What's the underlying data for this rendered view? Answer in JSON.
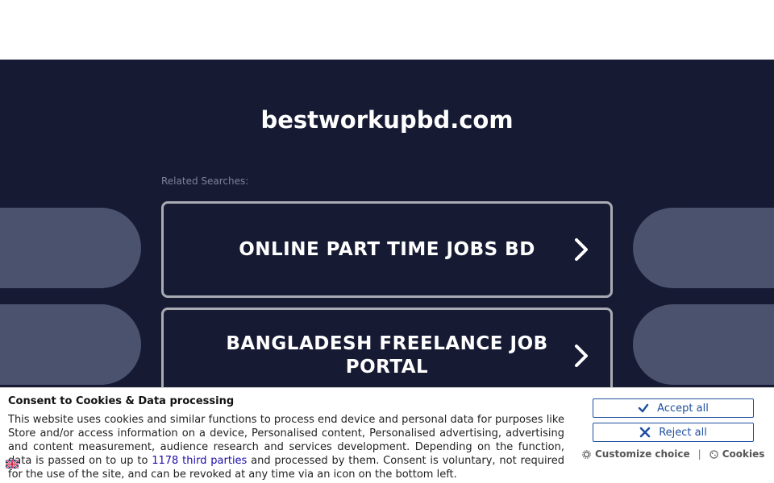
{
  "site": {
    "title": "bestworkupbd.com",
    "related_label": "Related Searches:"
  },
  "searches": [
    {
      "label": "ONLINE PART TIME JOBS BD"
    },
    {
      "label": "BANGLADESH FREELANCE JOB PORTAL"
    }
  ],
  "consent": {
    "title": "Consent to Cookies & Data processing",
    "text_before": "This website uses cookies and similar functions to process end device and personal data for purposes like Store and/or access information on a device, Personalised content, Personalised advertising, advertising and content measurement, audience research and services development. Depending on the function, data is passed on to up to ",
    "link_text": "1178 third parties",
    "text_after": " and processed by them. Consent is voluntary, not required for the use of the site, and can be revoked at any time via an icon on the bottom left.",
    "accept_label": "Accept all",
    "reject_label": "Reject all",
    "customize_label": "Customize choice",
    "cookies_label": "Cookies",
    "separator": "|"
  },
  "colors": {
    "background": "#161a33",
    "pill": "#4b526e",
    "card_border": "#a9aab2",
    "button_blue": "#1f4f9e"
  },
  "icons": {
    "chevron": "chevron-right-icon",
    "accept": "check-icon",
    "reject": "x-icon",
    "customize": "gear-icon",
    "cookies": "cookie-icon",
    "language": "uk-flag-icon"
  }
}
